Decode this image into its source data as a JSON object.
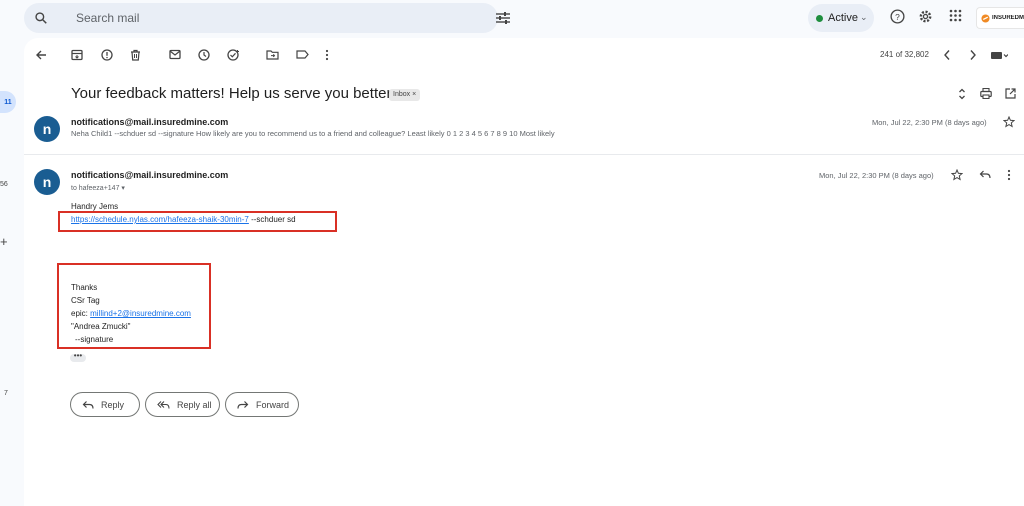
{
  "search": {
    "placeholder": "Search mail"
  },
  "status": {
    "label": "Active"
  },
  "brand": {
    "text": "INSUREDMI"
  },
  "rail": {
    "badge": "11",
    "count_56": "56",
    "count_7": "7",
    "plus": "+"
  },
  "toolbar": {
    "counter": "241 of 32,802"
  },
  "email": {
    "subject": "Your feedback matters! Help us serve you better",
    "label_chip": "Inbox ×",
    "collapsed": {
      "sender": "notifications@mail.insuredmine.com",
      "snippet": "Neha Child1 --schduer sd --signature How likely are you to recommend us to a friend and colleague? Least likely 0 1 2 3 4 5 6 7 8 9 10 Most likely",
      "time": "Mon, Jul 22, 2:30 PM (8 days ago)"
    },
    "expanded": {
      "sender": "notifications@mail.insuredmine.com",
      "to": "to hafeeza+147 ▾",
      "time": "Mon, Jul 22, 2:30 PM (8 days ago)",
      "greeting": "Handry Jems",
      "link": "https://schedule.nylas.com/hafeeza-shaik-30min-7",
      "after_link": " --schduer sd",
      "thanks": "Thanks",
      "csr": "CSr Tag",
      "epic_label": "epic: ",
      "epic_email": "millind+2@insuredmine.com",
      "name_quote": "\"Andrea Zmucki\"",
      "sig": "--signature",
      "more": "•••"
    },
    "avatar_letter": "n"
  },
  "actions": {
    "reply": "Reply",
    "reply_all": "Reply all",
    "forward": "Forward"
  },
  "colors": {
    "highlight_red": "#d93025",
    "avatar_blue": "#1a5d92",
    "link_blue": "#1a73e8",
    "active_green": "#1e8e3e"
  }
}
